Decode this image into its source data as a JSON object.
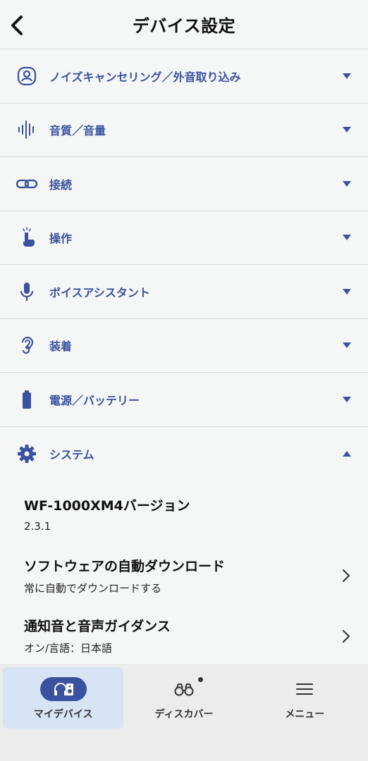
{
  "header": {
    "title": "デバイス設定"
  },
  "sections": [
    {
      "label": "ノイズキャンセリング／外音取り込み",
      "icon": "person-ambient-icon"
    },
    {
      "label": "音質／音量",
      "icon": "sound-wave-icon"
    },
    {
      "label": "接続",
      "icon": "link-icon"
    },
    {
      "label": "操作",
      "icon": "touch-icon"
    },
    {
      "label": "ボイスアシスタント",
      "icon": "microphone-icon"
    },
    {
      "label": "装着",
      "icon": "ear-icon"
    },
    {
      "label": "電源／バッテリー",
      "icon": "battery-icon"
    },
    {
      "label": "システム",
      "icon": "gear-icon"
    }
  ],
  "system": {
    "items": [
      {
        "title": "WF-1000XM4バージョン",
        "value": "2.3.1"
      },
      {
        "title": "ソフトウェアの自動ダウンロード",
        "value": "常に自動でダウンロードする"
      },
      {
        "title": "通知音と音声ガイダンス",
        "value": "オン/言語：日本語"
      }
    ]
  },
  "nav": {
    "items": [
      {
        "label": "マイデバイス",
        "icon": "headphones-speaker-icon"
      },
      {
        "label": "ディスカバー",
        "icon": "binoculars-icon"
      },
      {
        "label": "メニュー",
        "icon": "hamburger-menu-icon"
      }
    ]
  },
  "colors": {
    "accent": "#3a52a0",
    "background": "#f5f6f6",
    "nav_active": "#d6e4f5"
  }
}
